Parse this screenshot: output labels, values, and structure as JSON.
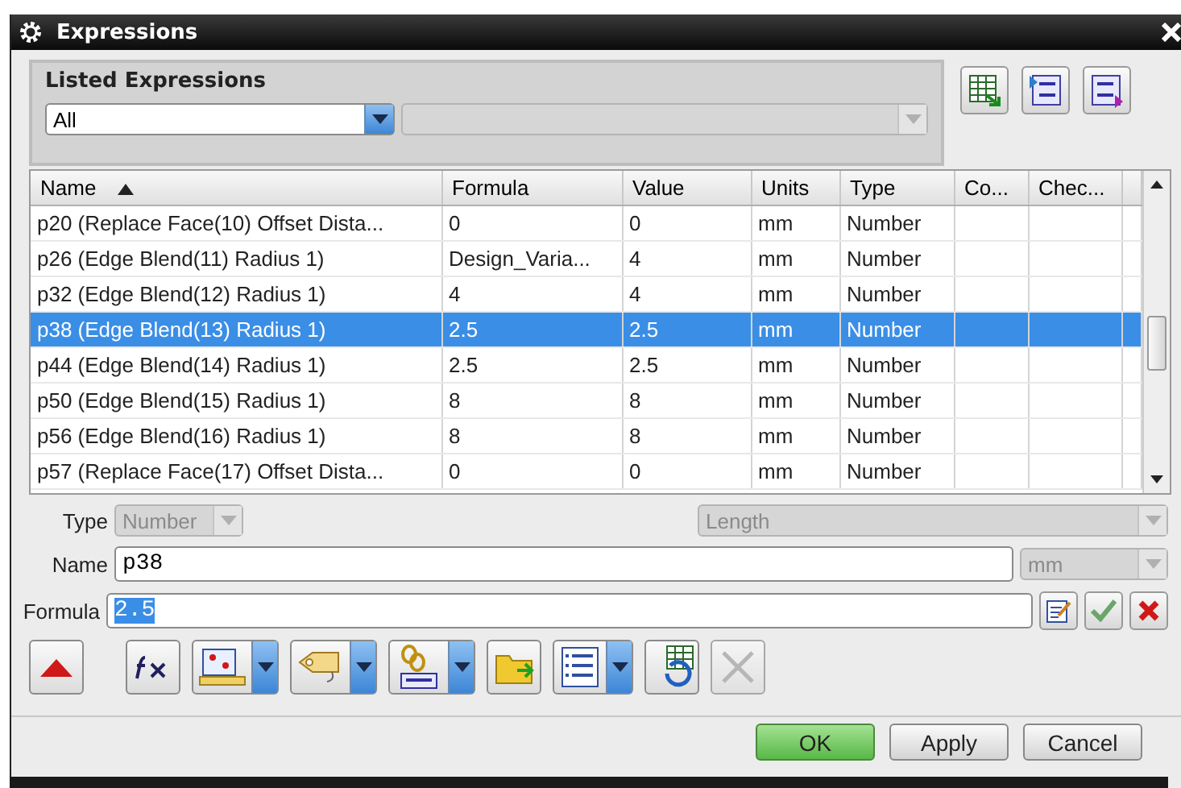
{
  "window": {
    "title": "Expressions"
  },
  "listed_expressions": {
    "title": "Listed Expressions",
    "filter": {
      "value": "All"
    },
    "second_filter": {
      "disabled": true
    }
  },
  "table": {
    "columns": [
      {
        "label": "Name",
        "sort_ascending": true
      },
      {
        "label": "Formula"
      },
      {
        "label": "Value"
      },
      {
        "label": "Units"
      },
      {
        "label": "Type"
      },
      {
        "label": "Co..."
      },
      {
        "label": "Chec..."
      }
    ],
    "rows": [
      {
        "cells": [
          "p20  (Replace Face(10) Offset Dista...",
          "0",
          "0",
          "mm",
          "Number"
        ],
        "selected": false
      },
      {
        "cells": [
          "p26  (Edge Blend(11) Radius 1)",
          "Design_Varia...",
          "4",
          "mm",
          "Number"
        ],
        "selected": false
      },
      {
        "cells": [
          "p32  (Edge Blend(12) Radius 1)",
          "4",
          "4",
          "mm",
          "Number"
        ],
        "selected": false
      },
      {
        "cells": [
          "p38  (Edge Blend(13) Radius 1)",
          "2.5",
          "2.5",
          "mm",
          "Number"
        ],
        "selected": true
      },
      {
        "cells": [
          "p44  (Edge Blend(14) Radius 1)",
          "2.5",
          "2.5",
          "mm",
          "Number"
        ],
        "selected": false
      },
      {
        "cells": [
          "p50  (Edge Blend(15) Radius 1)",
          "8",
          "8",
          "mm",
          "Number"
        ],
        "selected": false
      },
      {
        "cells": [
          "p56  (Edge Blend(16) Radius 1)",
          "8",
          "8",
          "mm",
          "Number"
        ],
        "selected": false
      },
      {
        "cells": [
          "p57  (Replace Face(17) Offset Dista...",
          "0",
          "0",
          "mm",
          "Number"
        ],
        "selected": false
      }
    ]
  },
  "type": {
    "label": "Type",
    "value": "Number",
    "disabled": true,
    "dimension": "Length"
  },
  "name": {
    "label": "Name",
    "value": "p38",
    "units": "mm",
    "units_disabled": true
  },
  "formula": {
    "label": "Formula",
    "value": "2.5",
    "text_selected": true
  },
  "dialog_buttons": [
    {
      "label": "OK",
      "kind": "primary"
    },
    {
      "label": "Apply",
      "kind": "normal"
    },
    {
      "label": "Cancel",
      "kind": "normal"
    }
  ]
}
